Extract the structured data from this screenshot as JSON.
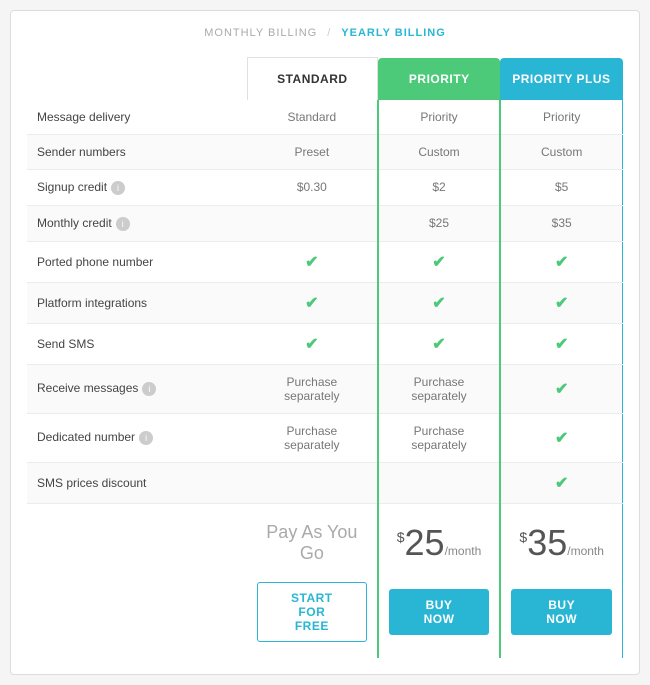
{
  "billing": {
    "monthly_label": "MONTHLY BILLING",
    "divider": "/",
    "yearly_label": "YEARLY BILLING"
  },
  "columns": {
    "label": "",
    "standard": "STANDARD",
    "priority": "PRIORITY",
    "priority_plus": "PRIORITY PLUS"
  },
  "rows": [
    {
      "feature": "Message delivery",
      "standard": "Standard",
      "priority": "Priority",
      "priority_plus": "Priority",
      "has_info": false
    },
    {
      "feature": "Sender numbers",
      "standard": "Preset",
      "priority": "Custom",
      "priority_plus": "Custom",
      "has_info": false
    },
    {
      "feature": "Signup credit",
      "standard": "$0.30",
      "priority": "$2",
      "priority_plus": "$5",
      "has_info": true
    },
    {
      "feature": "Monthly credit",
      "standard": "",
      "priority": "$25",
      "priority_plus": "$35",
      "has_info": true
    },
    {
      "feature": "Ported phone number",
      "standard": "check",
      "priority": "check",
      "priority_plus": "check",
      "has_info": false
    },
    {
      "feature": "Platform integrations",
      "standard": "check",
      "priority": "check",
      "priority_plus": "check",
      "has_info": false
    },
    {
      "feature": "Send SMS",
      "standard": "check",
      "priority": "check",
      "priority_plus": "check",
      "has_info": false
    },
    {
      "feature": "Receive messages",
      "standard": "Purchase separately",
      "priority": "Purchase separately",
      "priority_plus": "check",
      "has_info": true
    },
    {
      "feature": "Dedicated number",
      "standard": "Purchase separately",
      "priority": "Purchase separately",
      "priority_plus": "check",
      "has_info": true
    },
    {
      "feature": "SMS prices discount",
      "standard": "",
      "priority": "",
      "priority_plus": "check",
      "has_info": false
    }
  ],
  "footer": {
    "standard_price_label": "Pay As You Go",
    "priority_price_symbol": "$",
    "priority_price_amount": "25",
    "priority_price_period": "/month",
    "priority_plus_price_symbol": "$",
    "priority_plus_price_amount": "35",
    "priority_plus_price_period": "/month"
  },
  "buttons": {
    "start_free": "START FOR FREE",
    "buy_now_priority": "BUY NOW",
    "buy_now_priority_plus": "BUY NOW"
  },
  "icons": {
    "check": "✔",
    "info": "i"
  }
}
